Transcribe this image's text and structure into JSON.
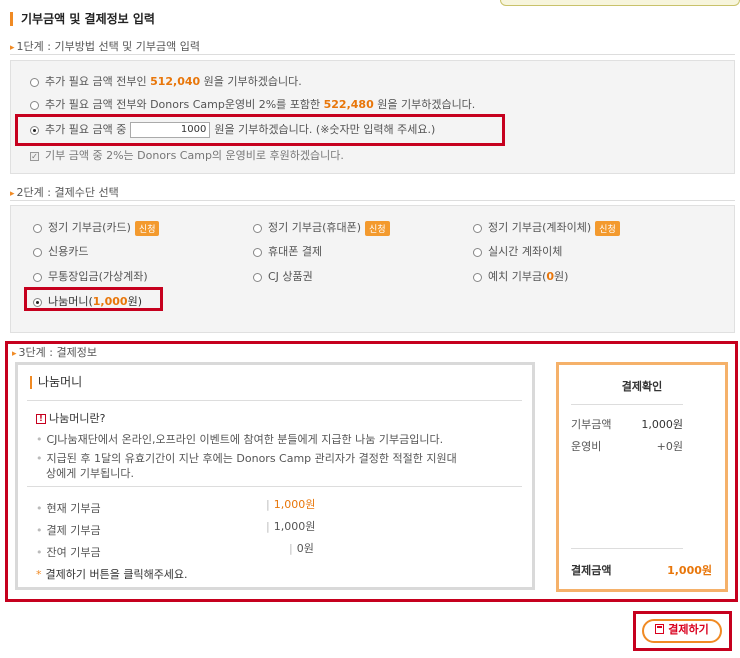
{
  "header": {
    "title": "기부금액 및 결제정보 입력"
  },
  "step1": {
    "label": "1단계 : 기부방법 선택 및 기부금액 입력",
    "opt1_pre": "추가 필요 금액 전부인 ",
    "opt1_amount": "512,040",
    "opt1_post": " 원을 기부하겠습니다.",
    "opt2_pre": "추가 필요 금액 전부와 Donors Camp운영비 2%를 포함한 ",
    "opt2_amount": "522,480",
    "opt2_post": " 원을 기부하겠습니다.",
    "opt3_pre": "추가 필요 금액 중",
    "opt3_value": "1000",
    "opt3_post": "원을 기부하겠습니다. (※숫자만 입력해 주세요.)",
    "checkbox_label": "기부 금액 중 2%는 Donors Camp의 운영비로 후원하겠습니다."
  },
  "step2": {
    "label": "2단계 : 결제수단 선택",
    "badge": "신청",
    "methods": {
      "card": "정기 기부금(카드)",
      "phone_regular": "정기 기부금(휴대폰)",
      "transfer_regular": "정기 기부금(계좌이체)",
      "credit": "신용카드",
      "phone": "휴대폰 결제",
      "realtime": "실시간 계좌이체",
      "deposit": "무통장입금(가상계좌)",
      "cj": "CJ 상품권",
      "prepaid_pre": "예치 기부금(",
      "prepaid_amount": "0",
      "prepaid_post": "원)",
      "nanum_pre": "나눔머니(",
      "nanum_amount": "1,000",
      "nanum_post": "원)"
    }
  },
  "step3": {
    "label": "3단계 : 결제정보",
    "panel_title": "나눔머니",
    "info_icon": "info-icon",
    "info_title": "나눔머니란?",
    "info_line1": "CJ나눔재단에서 온라인,오프라인 이벤트에 참여한 분들에게 지급한 나눔 기부금입니다.",
    "info_line2a": "지급된 후 1달의 유효기간이 지난 후에는 Donors Camp 관리자가 결정한 적절한 지원대",
    "info_line2b": "상에게 기부됩니다.",
    "current_label": "현재 기부금",
    "current_value": "1,000원",
    "payment_label": "결제 기부금",
    "payment_value": "1,000원",
    "remain_label": "잔여 기부금",
    "remain_value": "0원",
    "notice": "결제하기 버튼을 클릭해주세요."
  },
  "confirm": {
    "title": "결제확인",
    "donation_label": "기부금액",
    "donation_value": "1,000원",
    "fee_label": "운영비",
    "fee_value": "+0원",
    "total_label": "결제금액",
    "total_value": "1,000원"
  },
  "pay_button": {
    "label": "결제하기",
    "icon": "calculator-icon"
  },
  "colors": {
    "accent": "#f08a24",
    "highlight": "#c6001e",
    "amount": "#e8760a"
  }
}
